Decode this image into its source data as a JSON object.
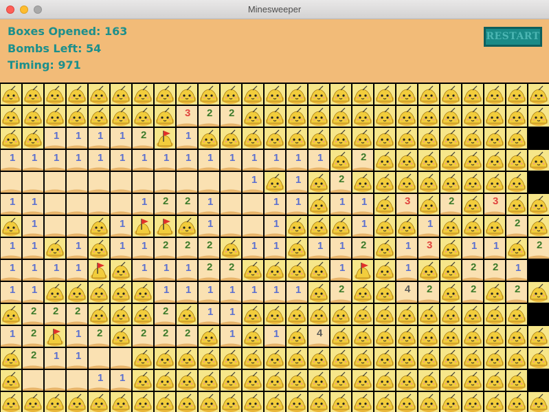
{
  "window": {
    "title": "Minesweeper"
  },
  "stats": {
    "opened_label": "Boxes Opened: 163",
    "bombs_label": "Bombs Left: 54",
    "timing_label": "Timing: 971"
  },
  "restart_label": "RESTART",
  "colors": {
    "header": "#f2bb78",
    "accent": "#1c8f8c",
    "closed": "#f6e68a",
    "open": "#fae1b2"
  },
  "legend": {
    "c": "closed",
    "f": "flagged",
    "0-4": "opened with adjacent bomb count"
  },
  "grid": [
    "ccccccccccccccccccccccccc",
    "cccccccc322cccccccccccccc",
    "cc11112f1ccccccccccccccc",
    "111111111111111c2cccccccc",
    "000000000001c1c2cccccccc",
    "11000012210011c11c3c2c3ccc",
    "c100c1ffc1001ccc1cc1ccc2cc",
    "11c1c11222c11c112c13c11c21",
    "1111fc11122cccc1fc1cc221",
    "11ccccc1111111c2cc42c2c2c1c",
    "c222ccc2c11ccccccccccccc",
    "12f12c222c1c1c4cccccccccc",
    "c21100ccccccccccccccccccc",
    "c00011cccccccccccccccccc",
    "ccccccccccccccccccccccccc"
  ]
}
